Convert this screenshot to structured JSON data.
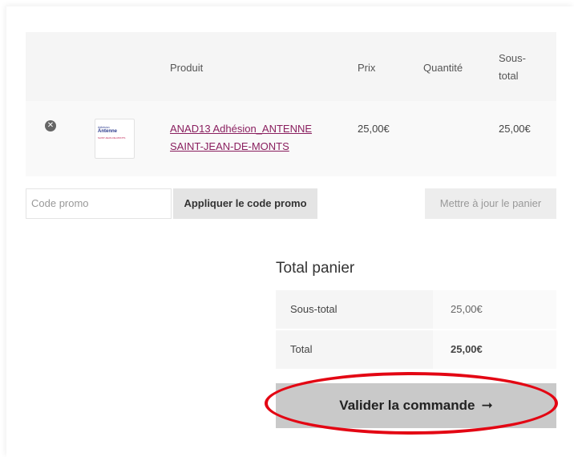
{
  "table": {
    "headers": {
      "product": "Produit",
      "price": "Prix",
      "quantity": "Quantité",
      "subtotal_line1": "Sous-",
      "subtotal_line2": "total"
    },
    "items": [
      {
        "remove_glyph": "✕",
        "thumb": {
          "line1": "Adhésion",
          "line2": "Antenne",
          "line3": "SAINT-JEAN-DE-MONTS"
        },
        "name_line1": "ANAD13 Adhésion_ANTENNE",
        "name_line2": "SAINT-JEAN-DE-MONTS",
        "price": "25,00€",
        "subtotal": "25,00€"
      }
    ]
  },
  "actions": {
    "promo_placeholder": "Code promo",
    "apply_label": "Appliquer le code promo",
    "update_label": "Mettre à jour le panier"
  },
  "totals": {
    "title": "Total panier",
    "rows": [
      {
        "label": "Sous-total",
        "value": "25,00€"
      },
      {
        "label": "Total",
        "value": "25,00€"
      }
    ],
    "checkout_label": "Valider la commande",
    "checkout_arrow": "➞"
  },
  "colors": {
    "link": "#8a1f5f",
    "highlight": "#e30613",
    "checkout_bg": "#c9c9c9"
  }
}
